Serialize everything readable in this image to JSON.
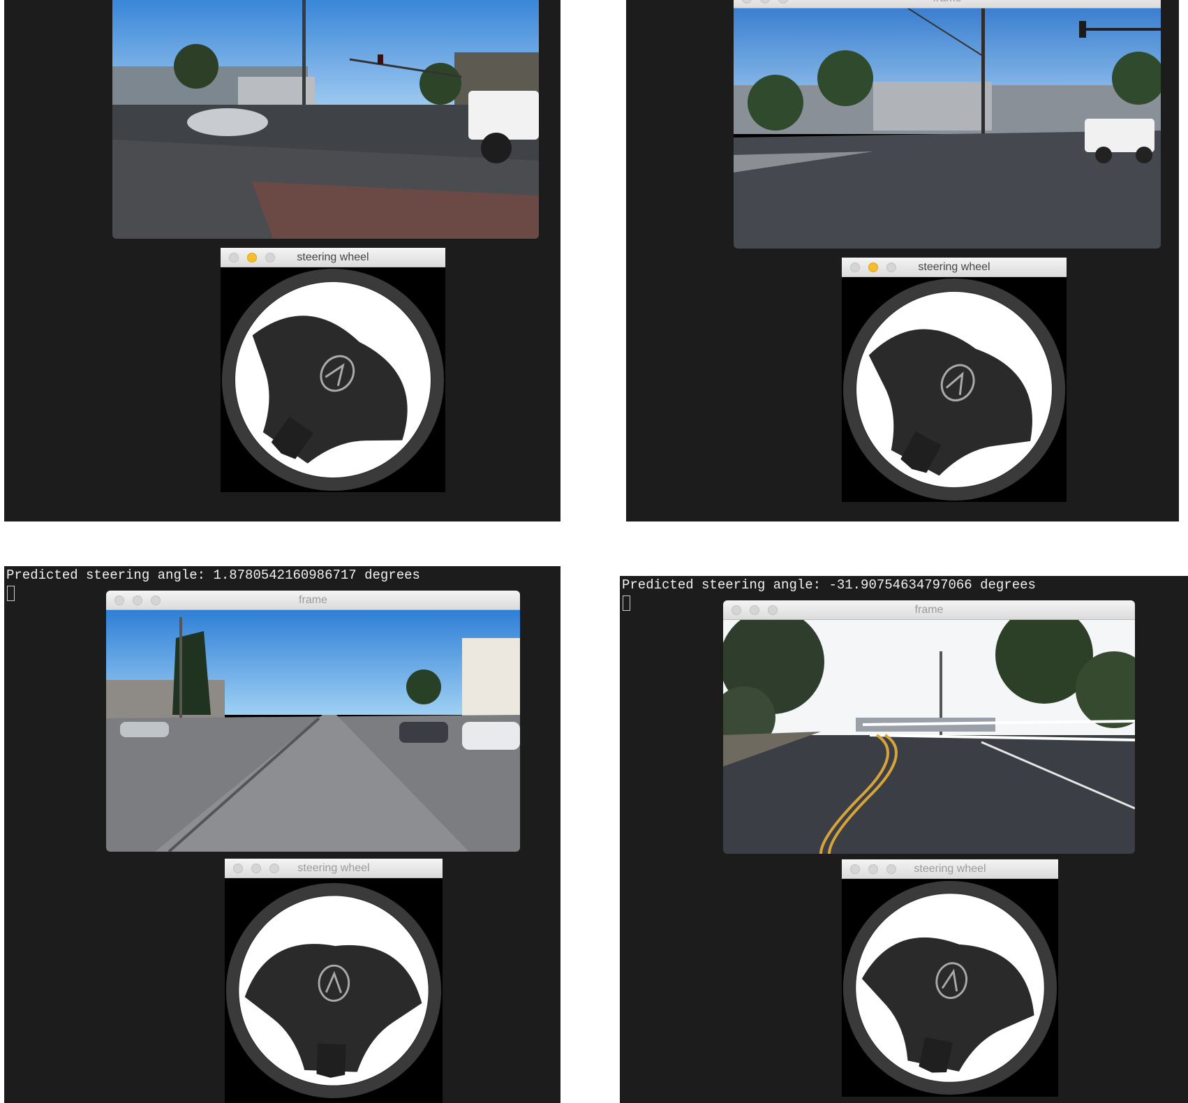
{
  "panels": [
    {
      "terminal_text": "",
      "frame_window": {
        "title": "",
        "title_dimmed": false,
        "lights": [
          "gray",
          "gray",
          "gray"
        ]
      },
      "wheel_window": {
        "title": "steering wheel",
        "lights": [
          "gray",
          "yellow",
          "gray"
        ]
      },
      "wheel_rotation_deg": 35
    },
    {
      "terminal_text": "",
      "frame_window": {
        "title": "frame",
        "title_dimmed": true,
        "lights": [
          "gray",
          "gray",
          "gray"
        ]
      },
      "wheel_window": {
        "title": "steering wheel",
        "lights": [
          "gray",
          "yellow",
          "gray"
        ]
      },
      "wheel_rotation_deg": 28
    },
    {
      "terminal_text": "Predicted steering angle: 1.8780542160986717 degrees",
      "frame_window": {
        "title": "frame",
        "title_dimmed": true,
        "lights": [
          "gray",
          "gray",
          "gray"
        ]
      },
      "wheel_window": {
        "title": "steering wheel",
        "lights": [
          "gray",
          "gray",
          "gray"
        ]
      },
      "wheel_rotation_deg": 2
    },
    {
      "terminal_text": "Predicted steering angle: -31.90754634797066 degrees",
      "frame_window": {
        "title": "frame",
        "title_dimmed": true,
        "lights": [
          "gray",
          "gray",
          "gray"
        ]
      },
      "wheel_window": {
        "title": "steering wheel",
        "lights": [
          "gray",
          "gray",
          "gray"
        ]
      },
      "wheel_rotation_deg": 12
    }
  ],
  "colors": {
    "terminal_bg": "#1c1c1c",
    "terminal_text": "#f2f2f2",
    "titlebar": "#e8e8e8",
    "light_gray": "#d5d5d5",
    "light_yellow": "#f6be2d"
  }
}
